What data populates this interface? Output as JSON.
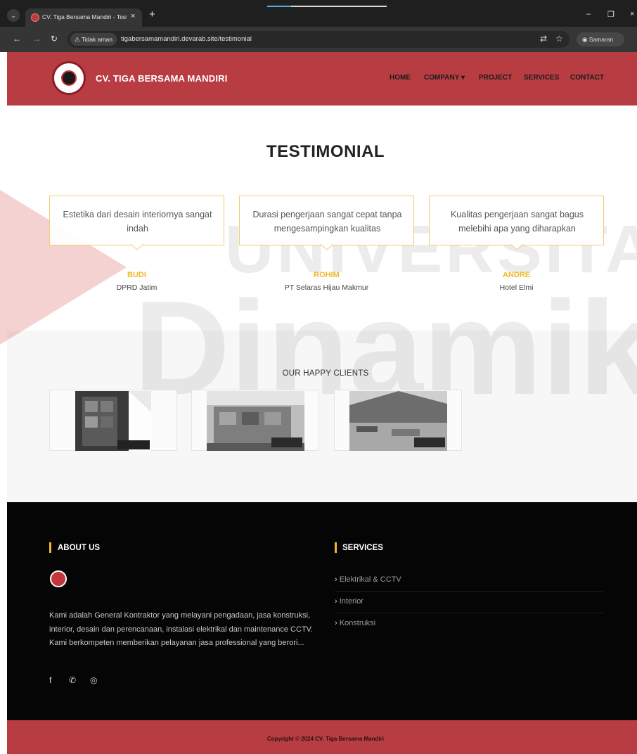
{
  "browser": {
    "tab_title": "CV. Tiga Bersama Mandiri - Test",
    "tab_close": "×",
    "new_tab": "+",
    "security_label": "Tidak aman",
    "url": "tigabersamamandiri.devarab.site/testimonial",
    "profile_label": "Samaran",
    "window_controls": {
      "minimize": "–",
      "restore": "❐",
      "close": "×"
    }
  },
  "header": {
    "brand": "CV. TIGA BERSAMA MANDIRI",
    "nav": {
      "home": "HOME",
      "company": "COMPANY ▾",
      "project": "PROJECT",
      "services": "SERVICES",
      "contact": "CONTACT"
    }
  },
  "watermark": {
    "line1": "UNIVERSITAS",
    "line2": "Dinamika"
  },
  "page": {
    "title": "TESTIMONIAL"
  },
  "testimonials": [
    {
      "quote": "Estetika dari desain interiornya sangat indah",
      "name": "BUDI",
      "role": "DPRD Jatim"
    },
    {
      "quote": "Durasi pengerjaan sangat cepat tanpa mengesampingkan kualitas",
      "name": "ROHIM",
      "role": "PT Selaras Hijau Makmur"
    },
    {
      "quote": "Kualitas pengerjaan sangat bagus melebihi apa yang diharapkan",
      "name": "ANDRE",
      "role": "Hotel Elmi"
    }
  ],
  "clients": {
    "title": "OUR HAPPY CLIENTS"
  },
  "footer": {
    "about_title": "ABOUT US",
    "about_text": "Kami adalah General Kontraktor yang melayani pengadaan, jasa konstruksi, interior, desain dan perencanaan, instalasi elektrikal dan maintenance CCTV. Kami berkompeten memberikan pelayanan jasa professional yang berori...",
    "services_title": "SERVICES",
    "services": [
      "Elektrikal & CCTV",
      "Interior",
      "Konstruksi"
    ],
    "copyright": "Copyright © 2024 CV. Tiga Bersama Mandiri"
  },
  "colors": {
    "brand_red": "#b83d42",
    "accent_gold": "#f0b82a",
    "footer_bg": "#050505"
  }
}
